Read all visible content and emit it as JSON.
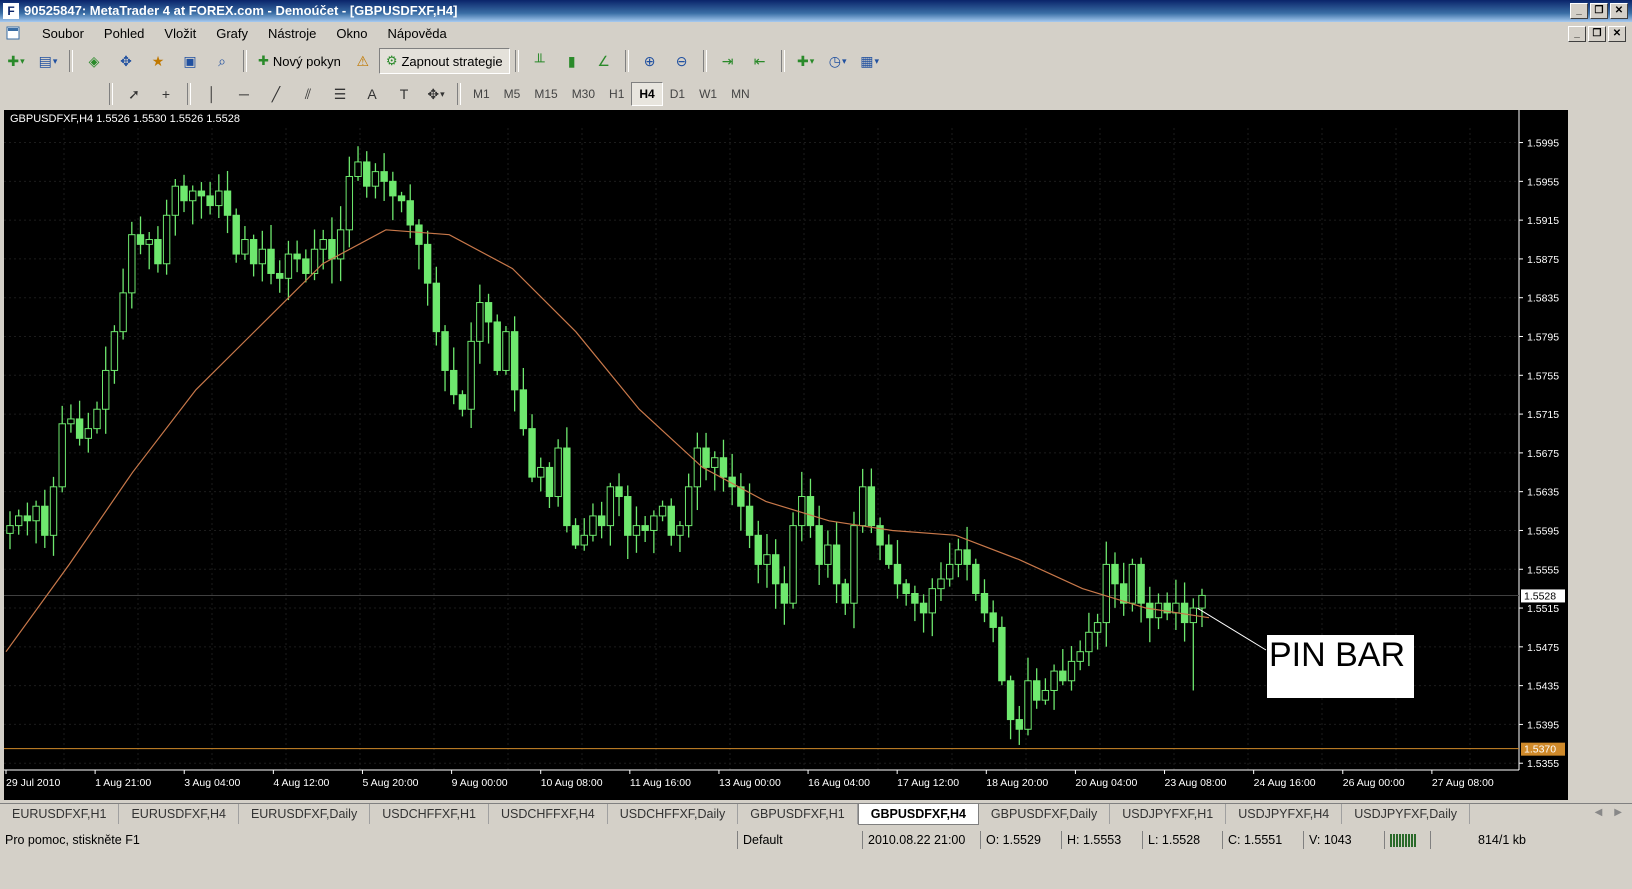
{
  "window": {
    "title": "90525847: MetaTrader 4 at FOREX.com - Demoúčet - [GBPUSDFXF,H4]",
    "app_icon": "F"
  },
  "menu": [
    "Soubor",
    "Pohled",
    "Vložit",
    "Grafy",
    "Nástroje",
    "Okno",
    "Nápověda"
  ],
  "toolbar": {
    "new_order_label": "Nový pokyn",
    "strategies_label": "Zapnout strategie",
    "timeframes": [
      "M1",
      "M5",
      "M15",
      "M30",
      "H1",
      "H4",
      "D1",
      "W1",
      "MN"
    ],
    "active_timeframe": "H4"
  },
  "chart": {
    "symbol_header": "GBPUSDFXF,H4  1.5526 1.5530 1.5526 1.5528",
    "pin_bar_label": "PIN BAR",
    "current_price": "1.5528",
    "hline_price": "1.5370"
  },
  "chart_data": {
    "type": "candlestick",
    "symbol": "GBPUSDFXF",
    "timeframe": "H4",
    "ohlc_last": {
      "open": 1.5526,
      "high": 1.553,
      "low": 1.5526,
      "close": 1.5528
    },
    "y_ticks": [
      "1.5995",
      "1.5955",
      "1.5915",
      "1.5875",
      "1.5835",
      "1.5795",
      "1.5755",
      "1.5715",
      "1.5675",
      "1.5635",
      "1.5595",
      "1.5555",
      "1.5515",
      "1.5475",
      "1.5435",
      "1.5395",
      "1.5355"
    ],
    "x_ticks": [
      "29 Jul 2010",
      "1 Aug 21:00",
      "3 Aug 04:00",
      "4 Aug 12:00",
      "5 Aug 20:00",
      "9 Aug 00:00",
      "10 Aug 08:00",
      "11 Aug 16:00",
      "13 Aug 00:00",
      "16 Aug 04:00",
      "17 Aug 12:00",
      "18 Aug 20:00",
      "20 Aug 04:00",
      "23 Aug 08:00",
      "24 Aug 16:00",
      "26 Aug 00:00",
      "27 Aug 08:00"
    ],
    "ylim": [
      1.5348,
      1.601
    ],
    "close_path": [
      1.56,
      1.561,
      1.5605,
      1.562,
      1.559,
      1.564,
      1.5705,
      1.571,
      1.569,
      1.57,
      1.572,
      1.576,
      1.58,
      1.584,
      1.59,
      1.589,
      1.5895,
      1.587,
      1.592,
      1.595,
      1.5935,
      1.5945,
      1.594,
      1.593,
      1.5945,
      1.592,
      1.588,
      1.5895,
      1.587,
      1.5885,
      1.586,
      1.5855,
      1.588,
      1.5875,
      1.586,
      1.5885,
      1.5895,
      1.5875,
      1.5905,
      1.596,
      1.5975,
      1.595,
      1.5965,
      1.5955,
      1.594,
      1.5935,
      1.591,
      1.589,
      1.585,
      1.58,
      1.576,
      1.5735,
      1.572,
      1.579,
      1.583,
      1.581,
      1.576,
      1.58,
      1.574,
      1.57,
      1.565,
      1.566,
      1.563,
      1.568,
      1.56,
      1.558,
      1.559,
      1.561,
      1.56,
      1.564,
      1.563,
      1.559,
      1.56,
      1.5595,
      1.561,
      1.562,
      1.559,
      1.56,
      1.564,
      1.568,
      1.566,
      1.567,
      1.565,
      1.564,
      1.562,
      1.559,
      1.556,
      1.557,
      1.554,
      1.552,
      1.56,
      1.563,
      1.56,
      1.556,
      1.558,
      1.554,
      1.552,
      1.56,
      1.564,
      1.56,
      1.558,
      1.556,
      1.554,
      1.553,
      1.552,
      1.551,
      1.5535,
      1.5545,
      1.556,
      1.5575,
      1.556,
      1.553,
      1.551,
      1.5495,
      1.544,
      1.54,
      1.539,
      1.544,
      1.542,
      1.543,
      1.545,
      1.544,
      1.546,
      1.547,
      1.549,
      1.55,
      1.556,
      1.554,
      1.552,
      1.556,
      1.552,
      1.5505,
      1.552,
      1.551,
      1.552,
      1.55,
      1.5515,
      1.5528
    ],
    "ma_path": [
      1.547,
      1.556,
      1.5655,
      1.574,
      1.5805,
      1.587,
      1.5905,
      1.59,
      1.5865,
      1.58,
      1.572,
      1.566,
      1.5625,
      1.5605,
      1.5595,
      1.559,
      1.5565,
      1.5535,
      1.5515,
      1.5505
    ],
    "annotations": [
      "PIN BAR"
    ]
  },
  "tabs": [
    "EURUSDFXF,H1",
    "EURUSDFXF,H4",
    "EURUSDFXF,Daily",
    "USDCHFFXF,H1",
    "USDCHFFXF,H4",
    "USDCHFFXF,Daily",
    "GBPUSDFXF,H1",
    "GBPUSDFXF,H4",
    "GBPUSDFXF,Daily",
    "USDJPYFXF,H1",
    "USDJPYFXF,H4",
    "USDJPYFXF,Daily"
  ],
  "active_tab": "GBPUSDFXF,H4",
  "status": {
    "help": "Pro pomoc, stiskněte F1",
    "profile": "Default",
    "datetime": "2010.08.22 21:00",
    "open": "O: 1.5529",
    "high": "H: 1.5553",
    "low": "L: 1.5528",
    "close": "C: 1.5551",
    "volume": "V: 1043",
    "traffic": "814/1 kb"
  },
  "colors": {
    "chart_bg": "#000000",
    "candle": "#6ee86e",
    "ma_line": "#c8784a",
    "axis_text": "#ffffff",
    "grid": "#1c1c1c",
    "hline": "#d08a2a"
  },
  "icons": {
    "new_chart": "new-chart-icon",
    "profiles": "profiles-icon",
    "market_watch": "market-watch-icon",
    "navigator": "navigator-icon",
    "terminal": "terminal-icon",
    "tester": "tester-icon",
    "history": "history-icon",
    "warning": "warning-icon",
    "bar_chart": "bar-chart-icon",
    "candle_chart": "candle-chart-icon",
    "line_chart": "line-chart-icon",
    "zoom_in": "zoom-in-icon",
    "zoom_out": "zoom-out-icon",
    "auto_scroll": "auto-scroll-icon",
    "chart_shift": "chart-shift-icon",
    "indicators": "indicators-icon",
    "periods": "periods-icon",
    "templates": "templates-icon",
    "cursor": "cursor-icon",
    "crosshair": "crosshair-icon",
    "vline": "vertical-line-icon",
    "hline": "horizontal-line-icon",
    "trendline": "trendline-icon",
    "fibonacci": "fibonacci-icon",
    "channel": "channel-icon",
    "text": "text-icon",
    "label": "label-icon",
    "arrows": "arrows-icon"
  }
}
